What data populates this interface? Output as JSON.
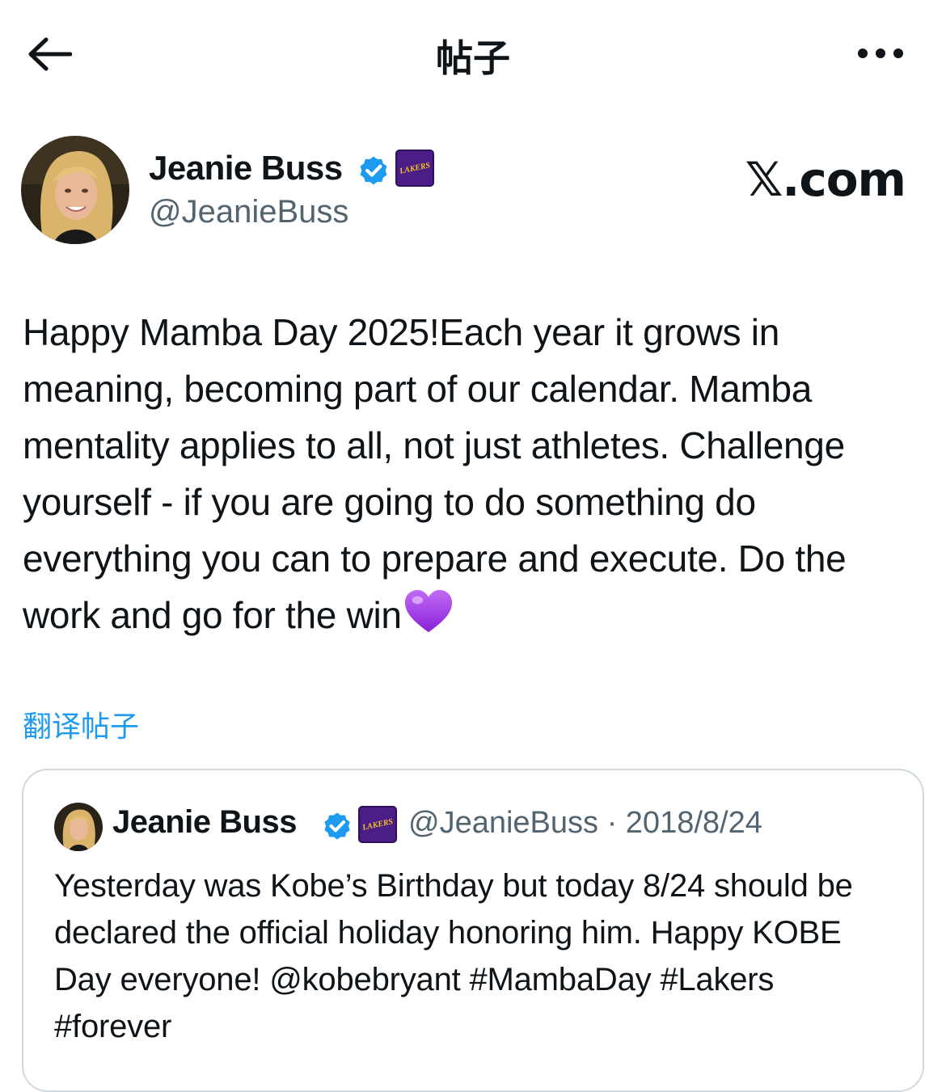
{
  "header": {
    "title": "帖子",
    "back_icon": "arrow-left-icon",
    "more_icon": "more-horizontal-icon"
  },
  "post": {
    "author_name": "Jeanie Buss",
    "handle": "@JeanieBuss",
    "verified_icon": "verified-badge-icon",
    "team_badge_text": "LAKERS",
    "brand": "𝕏.com",
    "text": "Happy Mamba Day 2025!Each year it grows in meaning, becoming part of our calendar. Mamba mentality applies to all, not just athletes. Challenge yourself - if you are going to do something do everything you can to prepare and execute. Do the work and go for the win",
    "emoji_icon": "purple-heart-icon",
    "translate_label": "翻译帖子"
  },
  "quoted": {
    "author_name": "Jeanie Buss",
    "handle_date": "@JeanieBuss · 2018/8/24",
    "team_badge_text": "LAKERS",
    "text": "Yesterday was Kobe’s Birthday but today 8/24 should be declared the official holiday honoring him. Happy KOBE Day everyone! @kobebryant #MambaDay #Lakers #forever"
  },
  "colors": {
    "link_blue": "#1d9bf0",
    "verified_blue": "#1d9bf0",
    "secondary_text": "#536471",
    "lakers_purple": "#4a1e86",
    "lakers_gold": "#f3c321",
    "heart_purple": "#9b30e8"
  }
}
